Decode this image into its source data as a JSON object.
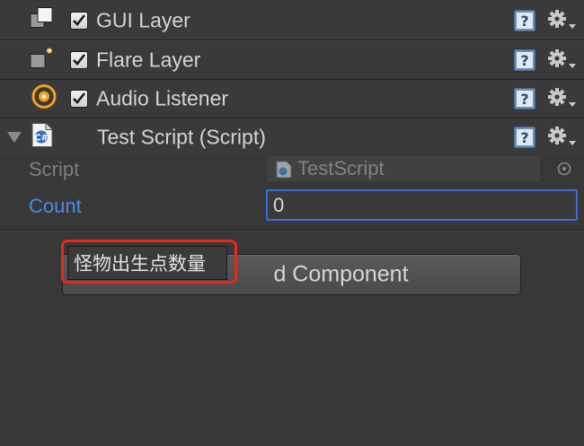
{
  "components": [
    {
      "title": "GUI Layer",
      "icon": "gui-layer-icon"
    },
    {
      "title": "Flare Layer",
      "icon": "flare-layer-icon"
    },
    {
      "title": "Audio Listener",
      "icon": "audio-listener-icon"
    }
  ],
  "script_component": {
    "title": "Test Script (Script)",
    "icon": "csharp-script-icon",
    "properties": {
      "script_label": "Script",
      "script_value": "TestScript",
      "count_label": "Count",
      "count_value": "0"
    }
  },
  "add_component_label": "d Component",
  "tooltip_text": "怪物出生点数量",
  "colors": {
    "background": "#383838",
    "focus_blue": "#3d6bd6",
    "count_label_blue": "#4d8ae6",
    "highlight_red": "#e8281a"
  }
}
